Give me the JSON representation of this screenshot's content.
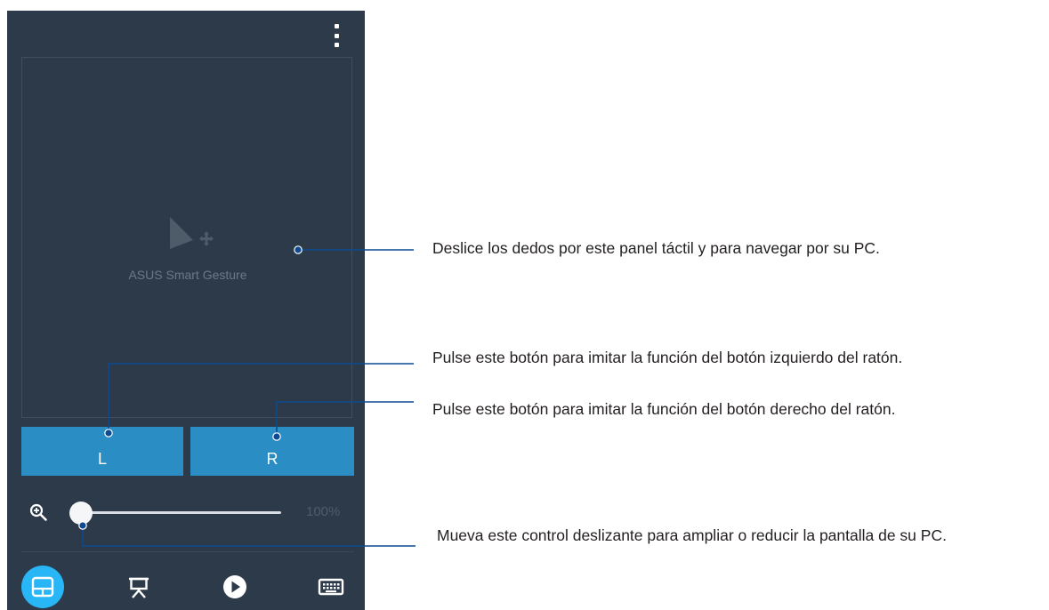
{
  "app": {
    "name": "ASUS Smart Gesture"
  },
  "touchpad": {
    "label": "ASUS Smart Gesture"
  },
  "buttons": {
    "left_label": "L",
    "right_label": "R"
  },
  "zoom": {
    "value_label": "100%",
    "level_fraction": 0.0
  },
  "nav": {
    "items": [
      {
        "name": "touchpad",
        "icon": "touchpad-icon",
        "active": true
      },
      {
        "name": "presentation",
        "icon": "presentation-icon",
        "active": false
      },
      {
        "name": "media",
        "icon": "play-icon",
        "active": false
      },
      {
        "name": "keyboard",
        "icon": "keyboard-icon",
        "active": false
      }
    ]
  },
  "callouts": {
    "touchpad": "Deslice los dedos por este panel táctil y para navegar por su PC.",
    "left_button": "Pulse este botón para imitar la función del botón izquierdo del ratón.",
    "right_button": "Pulse este botón para imitar la función del botón derecho del ratón.",
    "zoom_slider": "Mueva este control deslizante para ampliar o reducir la pantalla de su PC."
  },
  "colors": {
    "background": "#2c3a49",
    "button_blue": "#2a8ec5",
    "active_nav": "#29b6f6",
    "leader_line": "#0d4a91"
  }
}
